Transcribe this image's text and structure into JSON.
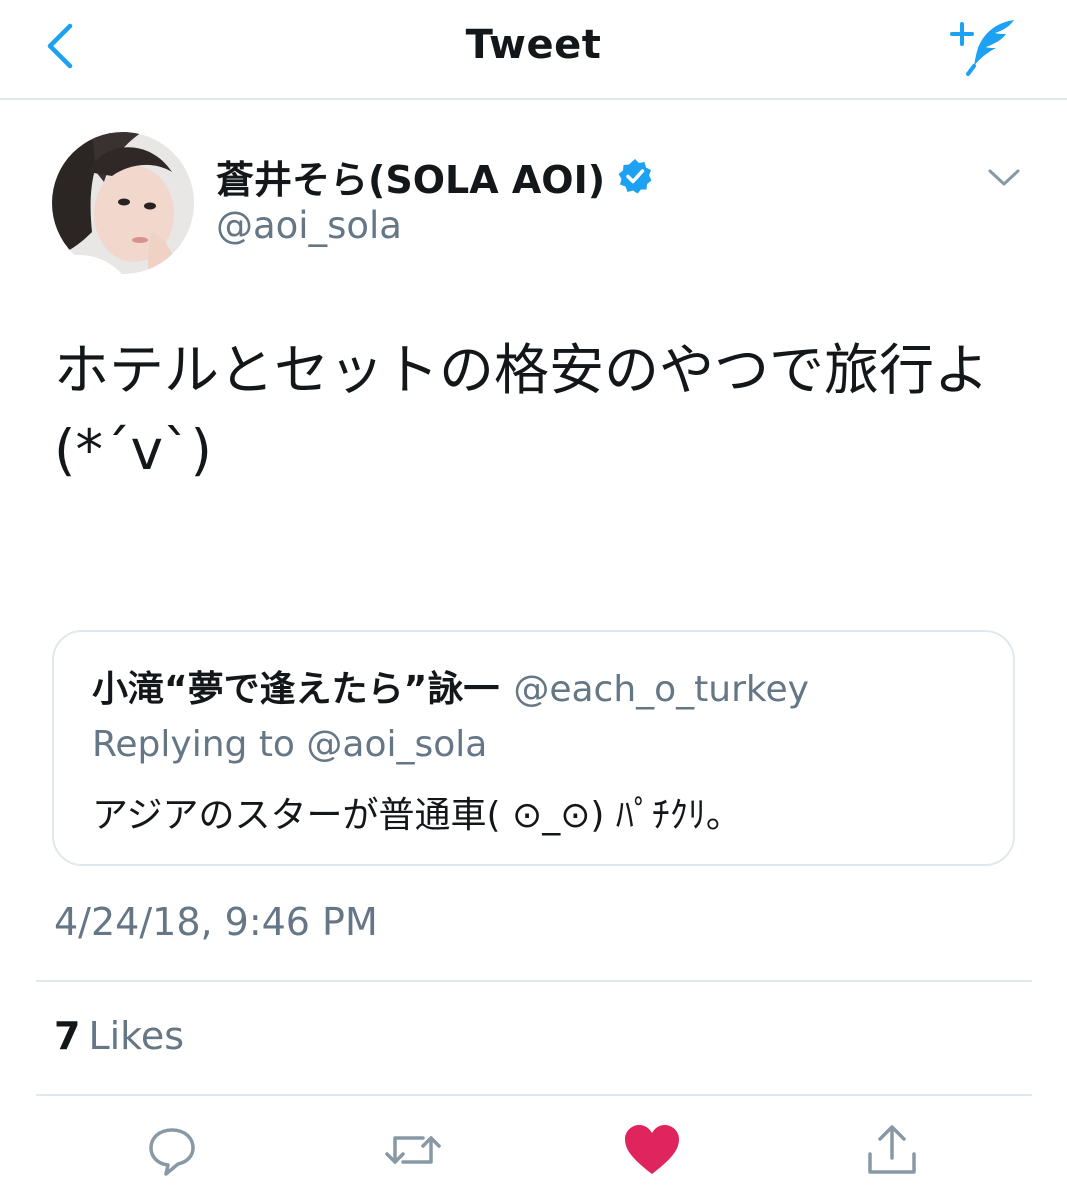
{
  "navbar": {
    "title": "Tweet",
    "back_icon": "chevron-left-icon",
    "compose_icon": "compose-feather-icon"
  },
  "tweet": {
    "author": {
      "display_name": "蒼井そら(SOLA AOI)",
      "handle": "@aoi_sola",
      "verified": true
    },
    "text": "ホテルとセットの格安のやつで旅行よ(*´v`)",
    "quoted": {
      "display_name": "小滝“夢で逢えたら”詠一",
      "handle": "@each_o_turkey",
      "replying_to": "Replying to @aoi_sola",
      "text": "アジアのスターが普通車( ⊙_⊙) ﾊﾟﾁｸﾘ。"
    },
    "timestamp": "4/24/18, 9:46 PM",
    "likes": {
      "count": "7",
      "label": "Likes"
    }
  },
  "actions": [
    {
      "icon": "reply-icon"
    },
    {
      "icon": "retweet-icon"
    },
    {
      "icon": "like-heart-icon",
      "active": true
    },
    {
      "icon": "share-icon"
    }
  ],
  "colors": {
    "accent": "#1da1f2",
    "like": "#e0245e",
    "secondary_text": "#657786",
    "divider": "#e1e8ed"
  }
}
